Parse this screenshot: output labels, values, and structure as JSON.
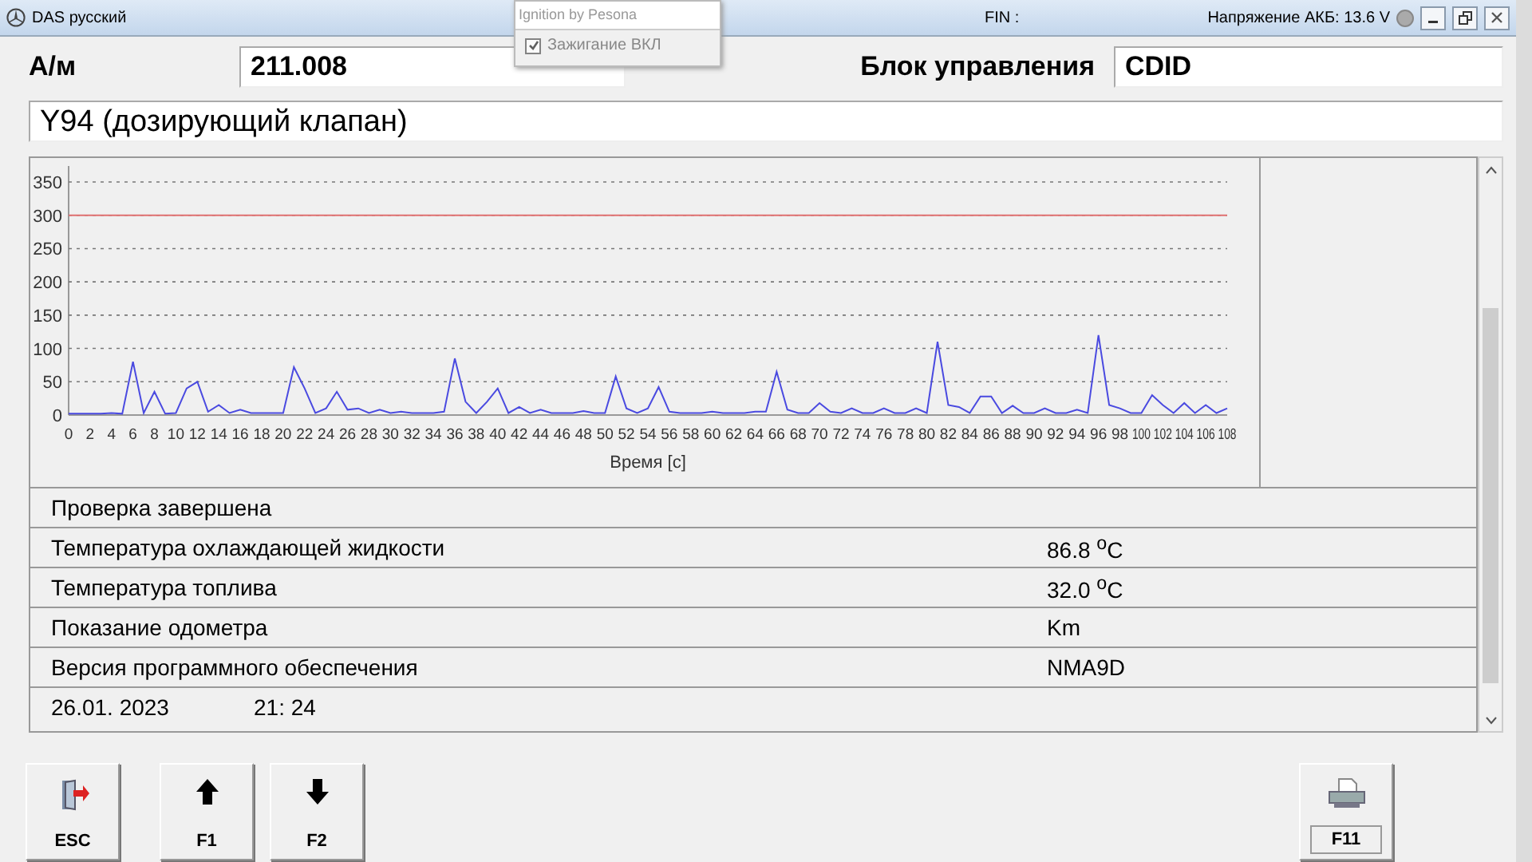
{
  "window": {
    "title": "DAS русский",
    "fin_label": "FIN :",
    "battery": "Напряжение АКБ: 13.6 V"
  },
  "popup": {
    "title": "Ignition by Pesona",
    "option": {
      "label": "Зажигание ВКЛ",
      "checked": true,
      "disabled": true
    }
  },
  "header": {
    "vehicle_label": "А/м",
    "vehicle_value": "211.008",
    "unit_label": "Блок управления",
    "unit_value": "CDID",
    "component": "Y94 (дозирующий клапан)"
  },
  "chart_data": {
    "type": "line",
    "xlabel": "Время [с]",
    "xlim": [
      0,
      108
    ],
    "ylim": [
      0,
      350
    ],
    "xticks": [
      0,
      2,
      4,
      6,
      8,
      10,
      12,
      14,
      16,
      18,
      20,
      22,
      24,
      26,
      28,
      30,
      32,
      34,
      36,
      38,
      40,
      42,
      44,
      46,
      48,
      50,
      52,
      54,
      56,
      58,
      60,
      62,
      64,
      66,
      68,
      70,
      72,
      74,
      76,
      78,
      80,
      82,
      84,
      86,
      88,
      90,
      92,
      94,
      96,
      98,
      100,
      102,
      104,
      106,
      108
    ],
    "yticks": [
      0,
      50,
      100,
      150,
      200,
      250,
      300,
      350
    ],
    "x": [
      0,
      1,
      2,
      3,
      4,
      5,
      6,
      7,
      8,
      9,
      10,
      11,
      12,
      13,
      14,
      15,
      16,
      17,
      18,
      19,
      20,
      21,
      22,
      23,
      24,
      25,
      26,
      27,
      28,
      29,
      30,
      31,
      32,
      33,
      34,
      35,
      36,
      37,
      38,
      39,
      40,
      41,
      42,
      43,
      44,
      45,
      46,
      47,
      48,
      49,
      50,
      51,
      52,
      53,
      54,
      55,
      56,
      57,
      58,
      59,
      60,
      61,
      62,
      63,
      64,
      65,
      66,
      67,
      68,
      69,
      70,
      71,
      72,
      73,
      74,
      75,
      76,
      77,
      78,
      79,
      80,
      81,
      82,
      83,
      84,
      85,
      86,
      87,
      88,
      89,
      90,
      91,
      92,
      93,
      94,
      95,
      96,
      97,
      98,
      99,
      100,
      101,
      102,
      103,
      104,
      105,
      106,
      107,
      108
    ],
    "grid": true,
    "series": [
      {
        "color": "#e07070",
        "values": [
          300,
          300,
          300,
          300,
          300,
          300,
          300,
          300,
          300,
          300,
          300,
          300,
          300,
          300,
          300,
          300,
          300,
          300,
          300,
          300,
          300,
          300,
          300,
          300,
          300,
          300,
          300,
          300,
          300,
          300,
          300,
          300,
          300,
          300,
          300,
          300,
          300,
          300,
          300,
          300,
          300,
          300,
          300,
          300,
          300,
          300,
          300,
          300,
          300,
          300,
          300,
          300,
          300,
          300,
          300,
          300,
          300,
          300,
          300,
          300,
          300,
          300,
          300,
          300,
          300,
          300,
          300,
          300,
          300,
          300,
          300,
          300,
          300,
          300,
          300,
          300,
          300,
          300,
          300,
          300,
          300,
          300,
          300,
          300,
          300,
          300,
          300,
          300,
          300,
          300,
          300,
          300,
          300,
          300,
          300,
          300,
          300,
          300,
          300,
          300,
          300,
          300,
          300,
          300,
          300,
          300,
          300,
          300,
          300
        ]
      },
      {
        "color": "#4a4ae0",
        "values": [
          2,
          2,
          2,
          2,
          3,
          2,
          80,
          3,
          35,
          2,
          3,
          40,
          50,
          5,
          15,
          3,
          8,
          3,
          3,
          3,
          3,
          72,
          40,
          3,
          10,
          35,
          8,
          10,
          3,
          8,
          3,
          5,
          3,
          3,
          3,
          5,
          85,
          20,
          3,
          20,
          40,
          3,
          12,
          3,
          8,
          3,
          3,
          3,
          6,
          3,
          3,
          58,
          10,
          3,
          10,
          42,
          5,
          3,
          3,
          3,
          5,
          3,
          3,
          3,
          5,
          5,
          65,
          8,
          3,
          3,
          18,
          5,
          3,
          10,
          3,
          3,
          10,
          3,
          3,
          10,
          3,
          110,
          15,
          12,
          3,
          28,
          28,
          3,
          14,
          3,
          3,
          10,
          3,
          3,
          8,
          3,
          120,
          15,
          10,
          3,
          3,
          30,
          15,
          3,
          18,
          3,
          15,
          3,
          10
        ]
      }
    ]
  },
  "rows": [
    {
      "label": "Проверка завершена"
    },
    {
      "label": "Температура охлаждающей жидкости",
      "value": "86.8 $^{o}$C"
    },
    {
      "label": "Температура топлива",
      "value": "32.0 $^{o}$C"
    },
    {
      "label": "Показание одометра",
      "value": "Km"
    },
    {
      "label": "Версия программного обеспечения",
      "value": "NMA9D"
    },
    {
      "label": "26.01. 2023",
      "value": "21: 24",
      "kind": "datetime"
    }
  ],
  "buttons": [
    {
      "label": "ESC",
      "kind": "exit"
    },
    {
      "label": "F1",
      "kind": "up"
    },
    {
      "label": "F2",
      "kind": "down"
    },
    {
      "label": "F11",
      "kind": "print"
    }
  ]
}
